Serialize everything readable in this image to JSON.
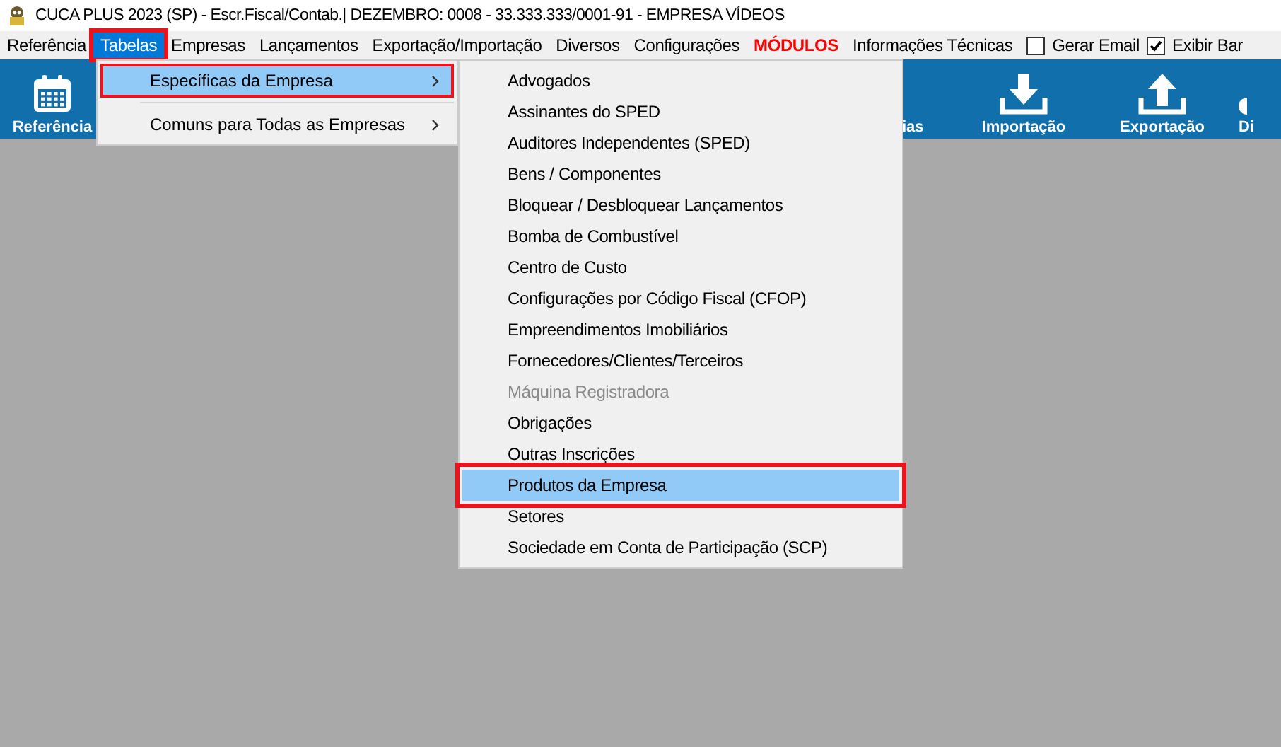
{
  "window": {
    "title": "CUCA PLUS 2023 (SP) - Escr.Fiscal/Contab.| DEZEMBRO: 0008 - 33.333.333/0001-91 - EMPRESA VÍDEOS"
  },
  "menu_bar": [
    {
      "label": "Referência",
      "selected": false,
      "kind": "menu",
      "annotated": false
    },
    {
      "label": "Tabelas",
      "selected": true,
      "kind": "menu",
      "annotated": true
    },
    {
      "label": "Empresas",
      "selected": false,
      "kind": "menu",
      "annotated": false
    },
    {
      "label": "Lançamentos",
      "selected": false,
      "kind": "menu",
      "annotated": false
    },
    {
      "label": "Exportação/Importação",
      "selected": false,
      "kind": "menu",
      "annotated": false
    },
    {
      "label": "Diversos",
      "selected": false,
      "kind": "menu",
      "annotated": false
    },
    {
      "label": "Configurações",
      "selected": false,
      "kind": "menu",
      "annotated": false
    },
    {
      "label": "MÓDULOS",
      "selected": false,
      "kind": "alert",
      "annotated": false
    },
    {
      "label": "Informações Técnicas",
      "selected": false,
      "kind": "menu",
      "annotated": false
    },
    {
      "label": "Gerar Email",
      "checked": false,
      "kind": "checkbox"
    },
    {
      "label": "Exibir Bar",
      "checked": true,
      "kind": "checkbox"
    }
  ],
  "toolbar": [
    {
      "label": "Referência",
      "kind": "calendar"
    },
    {
      "label": "ias",
      "kind": "none"
    },
    {
      "label": "Importação",
      "kind": "download"
    },
    {
      "label": "Exportação",
      "kind": "upload"
    },
    {
      "label": "Di",
      "kind": "circle"
    }
  ],
  "dropdown": [
    {
      "label": "Específicas da Empresa",
      "selected": true,
      "submenu": true,
      "annotated": true
    },
    {
      "label": "Comuns para Todas as Empresas",
      "selected": false,
      "submenu": true,
      "annotated": false
    }
  ],
  "submenu": [
    {
      "label": "Advogados",
      "selected": false,
      "disabled": false,
      "annotated": false
    },
    {
      "label": "Assinantes do SPED",
      "selected": false,
      "disabled": false,
      "annotated": false
    },
    {
      "label": "Auditores Independentes (SPED)",
      "selected": false,
      "disabled": false,
      "annotated": false
    },
    {
      "label": "Bens / Componentes",
      "selected": false,
      "disabled": false,
      "annotated": false
    },
    {
      "label": "Bloquear / Desbloquear Lançamentos",
      "selected": false,
      "disabled": false,
      "annotated": false
    },
    {
      "label": "Bomba de Combustível",
      "selected": false,
      "disabled": false,
      "annotated": false
    },
    {
      "label": "Centro de Custo",
      "selected": false,
      "disabled": false,
      "annotated": false
    },
    {
      "label": "Configurações por Código Fiscal (CFOP)",
      "selected": false,
      "disabled": false,
      "annotated": false
    },
    {
      "label": "Empreendimentos Imobiliários",
      "selected": false,
      "disabled": false,
      "annotated": false
    },
    {
      "label": "Fornecedores/Clientes/Terceiros",
      "selected": false,
      "disabled": false,
      "annotated": false
    },
    {
      "label": "Máquina Registradora",
      "selected": false,
      "disabled": true,
      "annotated": false
    },
    {
      "label": "Obrigações",
      "selected": false,
      "disabled": false,
      "annotated": false
    },
    {
      "label": "Outras Inscrições",
      "selected": false,
      "disabled": false,
      "annotated": false
    },
    {
      "label": "Produtos da Empresa",
      "selected": true,
      "disabled": false,
      "annotated": true
    },
    {
      "label": "Setores",
      "selected": false,
      "disabled": false,
      "annotated": false
    },
    {
      "label": "Sociedade em Conta de Participação (SCP)",
      "selected": false,
      "disabled": false,
      "annotated": false
    }
  ]
}
